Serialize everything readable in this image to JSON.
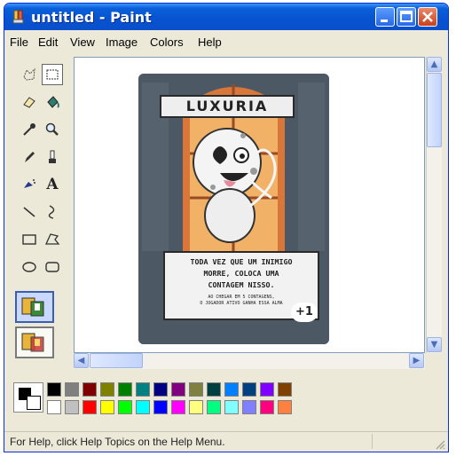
{
  "window": {
    "title": "untitled - Paint"
  },
  "menu": [
    "File",
    "Edit",
    "View",
    "Image",
    "Colors",
    "Help"
  ],
  "tools": [
    "free-form-select",
    "select",
    "eraser",
    "fill",
    "color-picker",
    "magnifier",
    "pencil",
    "brush",
    "airbrush",
    "text",
    "line",
    "curve",
    "rectangle",
    "polygon",
    "ellipse",
    "rounded-rectangle"
  ],
  "card": {
    "title": "LUXURIA",
    "main_text": [
      "TODA VEZ QUE UM INIMIGO",
      "MORRE, COLOCA UMA",
      "CONTAGEM NISSO."
    ],
    "sub_text": [
      "AO CHEGAR EM 5 CONTAGENS,",
      "O JOGADOR ATIVO GANHA ESSA ALMA"
    ],
    "bonus": "+1"
  },
  "palette": {
    "foreground": "#000000",
    "background": "#ffffff",
    "row1": [
      "#000000",
      "#808080",
      "#800000",
      "#808000",
      "#008000",
      "#008080",
      "#000080",
      "#800080",
      "#808040",
      "#004040",
      "#0080ff",
      "#004080",
      "#8000ff",
      "#804000"
    ],
    "row2": [
      "#ffffff",
      "#c0c0c0",
      "#ff0000",
      "#ffff00",
      "#00ff00",
      "#00ffff",
      "#0000ff",
      "#ff00ff",
      "#ffff80",
      "#00ff80",
      "#80ffff",
      "#8080ff",
      "#ff0080",
      "#ff8040"
    ]
  },
  "status": {
    "text": "For Help, click Help Topics on the Help Menu."
  }
}
